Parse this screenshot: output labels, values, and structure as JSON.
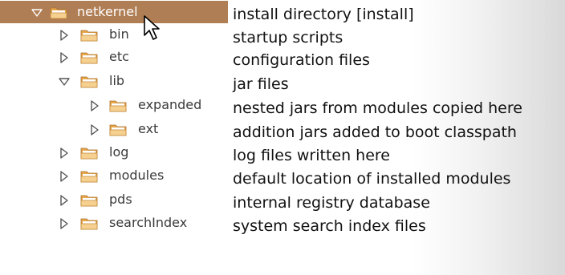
{
  "tree": [
    {
      "label": "netkernel",
      "expanded": true,
      "depth": 0,
      "selected": true,
      "description": "install directory [install]"
    },
    {
      "label": "bin",
      "expanded": false,
      "depth": 1,
      "selected": false,
      "description": "startup scripts"
    },
    {
      "label": "etc",
      "expanded": false,
      "depth": 1,
      "selected": false,
      "description": "configuration files"
    },
    {
      "label": "lib",
      "expanded": true,
      "depth": 1,
      "selected": false,
      "description": "jar files"
    },
    {
      "label": "expanded",
      "expanded": false,
      "depth": 2,
      "selected": false,
      "description": "nested jars from modules copied here"
    },
    {
      "label": "ext",
      "expanded": false,
      "depth": 2,
      "selected": false,
      "description": "addition jars added to boot classpath"
    },
    {
      "label": "log",
      "expanded": false,
      "depth": 1,
      "selected": false,
      "description": "log files written here"
    },
    {
      "label": "modules",
      "expanded": false,
      "depth": 1,
      "selected": false,
      "description": "default location of installed modules"
    },
    {
      "label": "pds",
      "expanded": false,
      "depth": 1,
      "selected": false,
      "description": "internal registry database"
    },
    {
      "label": "searchIndex",
      "expanded": false,
      "depth": 1,
      "selected": false,
      "description": "system search index files"
    }
  ],
  "icons": {
    "expanded_toggle": "triangle-down-icon",
    "collapsed_toggle": "triangle-right-icon",
    "folder": "folder-icon",
    "cursor": "mouse-pointer-icon"
  },
  "colors": {
    "selection": "#b07e55",
    "folder_body": "#e7a64a",
    "folder_tab": "#f4c77f",
    "folder_front": "#f6d08f",
    "toggle_stroke": "#555555"
  }
}
